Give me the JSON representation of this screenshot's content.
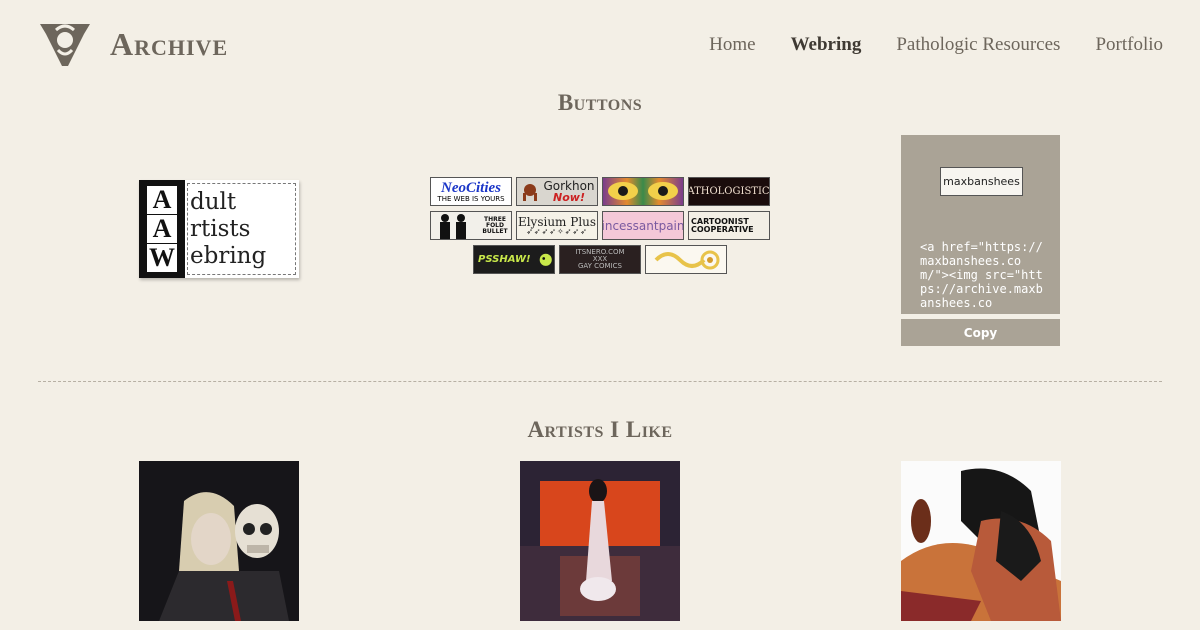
{
  "header": {
    "title": "Archive",
    "nav": [
      "Home",
      "Webring",
      "Pathologic Resources",
      "Portfolio"
    ],
    "active_nav": "Webring"
  },
  "buttons_section": {
    "title": "Buttons",
    "webring": {
      "letters": [
        "A",
        "A",
        "W"
      ],
      "lines": [
        "dult",
        "rtists",
        "ebring"
      ]
    },
    "badges": [
      {
        "name": "neocities",
        "line1": "NeoCities",
        "line2": "THE WEB IS YOURS"
      },
      {
        "name": "gorkhon-now",
        "line1": "Gorkhon",
        "line2": "Now!"
      },
      {
        "name": "eyes",
        "line1": ""
      },
      {
        "name": "pathologistics",
        "line1": "PATHOLOGISTICS"
      },
      {
        "name": "three-fold-bullet",
        "line1": "THREE FOLD BULLET"
      },
      {
        "name": "elysium-plus",
        "line1": "Elysium Plus"
      },
      {
        "name": "incessantpain",
        "line1": "incessantpain"
      },
      {
        "name": "cartoonist-cooperative",
        "line1": "CARTOONIST",
        "line2": "COOPERATIVE"
      },
      {
        "name": "psshaw",
        "line1": "PSSHAW!"
      },
      {
        "name": "itsnero",
        "line1": "ITSNERO.COM",
        "line2": "XXX",
        "line3": "GAY COMICS"
      },
      {
        "name": "swirl",
        "line1": ""
      }
    ],
    "code_preview": "maxbanshees",
    "code": "<a href=\"https://maxbanshees.com/\"><img src=\"https://archive.maxbanshees.co",
    "copy_label": "Copy"
  },
  "artists_section": {
    "title": "Artists I Like"
  },
  "colors": {
    "background": "#f3efe6",
    "text": "#6d665c",
    "code_box": "#aaa396"
  }
}
